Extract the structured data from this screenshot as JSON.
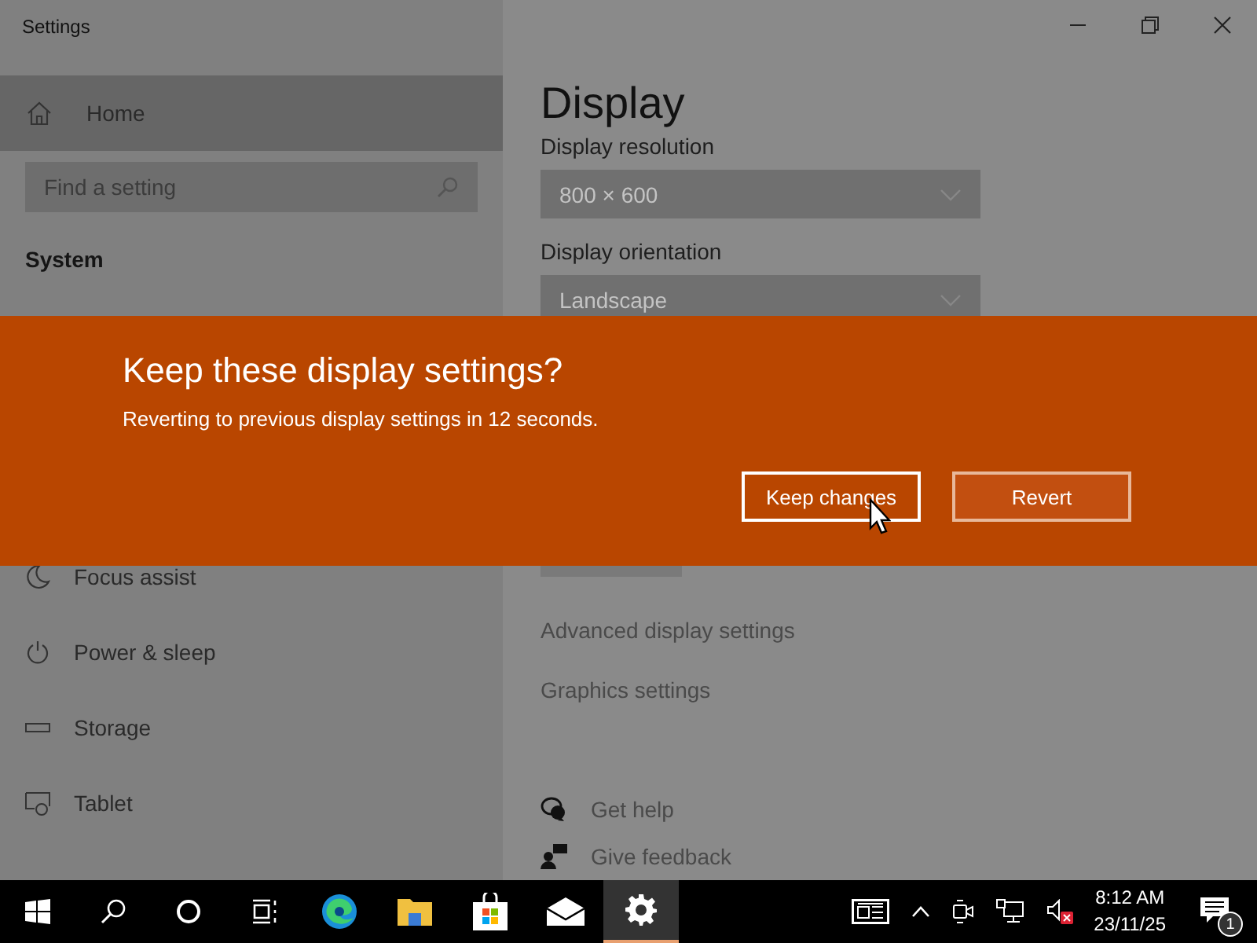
{
  "window": {
    "title": "Settings"
  },
  "sidebar": {
    "home": "Home",
    "search": {
      "placeholder": "Find a setting"
    },
    "section": "System",
    "items": [
      {
        "kind": "moon",
        "label": "Focus assist"
      },
      {
        "kind": "power",
        "label": "Power & sleep"
      },
      {
        "kind": "storage",
        "label": "Storage"
      },
      {
        "kind": "tablet",
        "label": "Tablet"
      }
    ]
  },
  "page": {
    "title": "Display",
    "settings": [
      {
        "label": "Display resolution",
        "value": "800 × 600"
      },
      {
        "label": "Display orientation",
        "value": "Landscape"
      }
    ],
    "links": [
      "Advanced display settings",
      "Graphics settings"
    ],
    "help": [
      {
        "kind": "help",
        "label": "Get help"
      },
      {
        "kind": "feedback",
        "label": "Give feedback"
      }
    ]
  },
  "dialog": {
    "title": "Keep these display settings?",
    "message": "Reverting to previous display settings in 12 seconds.",
    "buttons": [
      {
        "label": "Keep changes",
        "focused": true
      },
      {
        "label": "Revert",
        "focused": false
      }
    ]
  },
  "taskbar": {
    "apps": [
      {
        "kind": "start",
        "selected": false
      },
      {
        "kind": "search",
        "selected": false
      },
      {
        "kind": "cortana",
        "selected": false
      },
      {
        "kind": "taskview",
        "selected": false
      },
      {
        "kind": "edge",
        "selected": false
      },
      {
        "kind": "explorer",
        "selected": false
      },
      {
        "kind": "store",
        "selected": false
      },
      {
        "kind": "mail",
        "selected": false
      },
      {
        "kind": "settings",
        "selected": true
      }
    ],
    "clock": {
      "time": "8:12 AM",
      "date": "23/11/25"
    },
    "notifications": {
      "count": "1"
    }
  }
}
